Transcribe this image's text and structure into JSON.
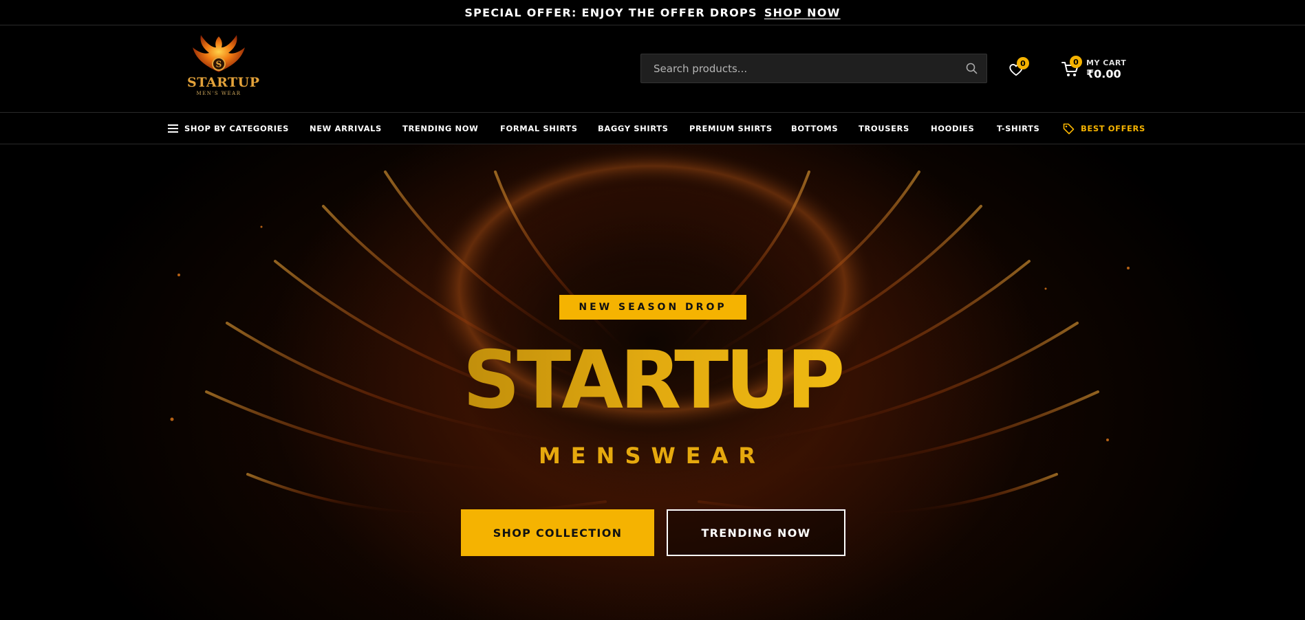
{
  "announcement": {
    "text": "SPECIAL OFFER: ENJOY THE OFFER DROPS",
    "link_label": "SHOP NOW"
  },
  "header": {
    "logo_text": "STARTUP",
    "logo_subtext": "MEN'S WEAR",
    "search_placeholder": "Search products...",
    "wishlist_count": "0",
    "cart_count": "0",
    "cart_label": "MY CART",
    "cart_total": "₹0.00"
  },
  "nav": {
    "items": [
      {
        "label": "SHOP BY CATEGORIES",
        "icon": "menu-icon"
      },
      {
        "label": "NEW ARRIVALS"
      },
      {
        "label": "TRENDING NOW"
      },
      {
        "label": "FORMAL SHIRTS"
      },
      {
        "label": "BAGGY SHIRTS"
      },
      {
        "label": "PREMIUM SHIRTS"
      },
      {
        "label": "BOTTOMS"
      },
      {
        "label": "TROUSERS"
      },
      {
        "label": "HOODIES"
      },
      {
        "label": "T-SHIRTS"
      },
      {
        "label": "BEST OFFERS",
        "icon": "tag-icon",
        "highlight": true
      }
    ]
  },
  "hero": {
    "tag": "NEW SEASON DROP",
    "title": "STARTUP",
    "subtitle": "MENSWEAR",
    "primary_button": "SHOP COLLECTION",
    "secondary_button": "TRENDING NOW"
  },
  "colors": {
    "accent": "#f5b301",
    "background": "#000000",
    "title_gold": "#e2aa10"
  }
}
